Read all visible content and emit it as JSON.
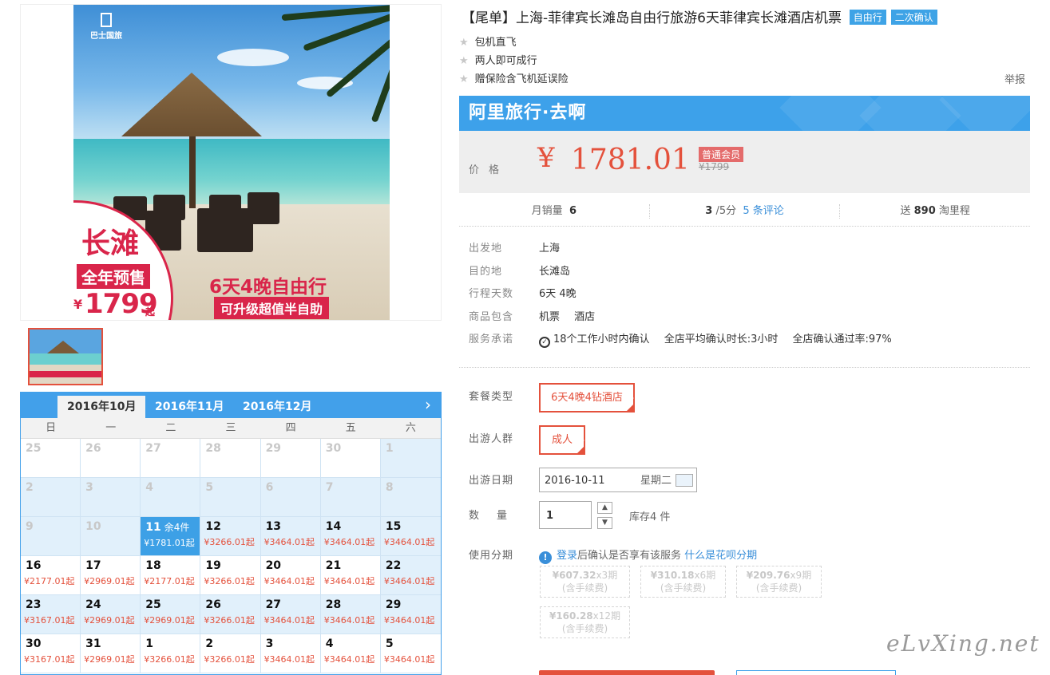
{
  "gallery": {
    "image_logo_text": "巴士国旅",
    "promo_place": "长滩",
    "promo_sale": "全年预售",
    "promo_price_symbol": "¥",
    "promo_price": "1799",
    "promo_price_suffix": "起",
    "promo_trip": "6天4晚自由行",
    "promo_upgrade": "可升级超值半自助"
  },
  "calendar": {
    "tabs": [
      "2016年10月",
      "2016年11月",
      "2016年12月"
    ],
    "active_tab": 0,
    "next_icon": "chevron-right-icon",
    "weekdays": [
      "日",
      "一",
      "二",
      "三",
      "四",
      "五",
      "六"
    ],
    "cells": [
      {
        "d": "25",
        "p": "",
        "bg": "white",
        "muted": true
      },
      {
        "d": "26",
        "p": "",
        "bg": "white",
        "muted": true
      },
      {
        "d": "27",
        "p": "",
        "bg": "white",
        "muted": true
      },
      {
        "d": "28",
        "p": "",
        "bg": "white",
        "muted": true
      },
      {
        "d": "29",
        "p": "",
        "bg": "white",
        "muted": true
      },
      {
        "d": "30",
        "p": "",
        "bg": "white",
        "muted": true
      },
      {
        "d": "1",
        "p": "",
        "bg": "blue",
        "muted": true
      },
      {
        "d": "2",
        "p": "",
        "bg": "blue",
        "muted": true
      },
      {
        "d": "3",
        "p": "",
        "bg": "blue",
        "muted": true
      },
      {
        "d": "4",
        "p": "",
        "bg": "blue",
        "muted": true
      },
      {
        "d": "5",
        "p": "",
        "bg": "blue",
        "muted": true
      },
      {
        "d": "6",
        "p": "",
        "bg": "blue",
        "muted": true
      },
      {
        "d": "7",
        "p": "",
        "bg": "blue",
        "muted": true
      },
      {
        "d": "8",
        "p": "",
        "bg": "blue",
        "muted": true
      },
      {
        "d": "9",
        "p": "",
        "bg": "blue",
        "muted": true
      },
      {
        "d": "10",
        "p": "",
        "bg": "blue",
        "muted": true
      },
      {
        "d": "11",
        "p": "¥1781.01起",
        "bg": "selected",
        "muted": false,
        "stock": "余4件"
      },
      {
        "d": "12",
        "p": "¥3266.01起",
        "bg": "blue",
        "muted": false
      },
      {
        "d": "13",
        "p": "¥3464.01起",
        "bg": "blue",
        "muted": false
      },
      {
        "d": "14",
        "p": "¥3464.01起",
        "bg": "blue",
        "muted": false
      },
      {
        "d": "15",
        "p": "¥3464.01起",
        "bg": "blue",
        "muted": false
      },
      {
        "d": "16",
        "p": "¥2177.01起",
        "bg": "white",
        "muted": false
      },
      {
        "d": "17",
        "p": "¥2969.01起",
        "bg": "white",
        "muted": false
      },
      {
        "d": "18",
        "p": "¥2177.01起",
        "bg": "white",
        "muted": false
      },
      {
        "d": "19",
        "p": "¥3266.01起",
        "bg": "white",
        "muted": false
      },
      {
        "d": "20",
        "p": "¥3464.01起",
        "bg": "white",
        "muted": false
      },
      {
        "d": "21",
        "p": "¥3464.01起",
        "bg": "white",
        "muted": false
      },
      {
        "d": "22",
        "p": "¥3464.01起",
        "bg": "blue",
        "muted": false
      },
      {
        "d": "23",
        "p": "¥3167.01起",
        "bg": "blue",
        "muted": false
      },
      {
        "d": "24",
        "p": "¥2969.01起",
        "bg": "blue",
        "muted": false
      },
      {
        "d": "25",
        "p": "¥2969.01起",
        "bg": "blue",
        "muted": false
      },
      {
        "d": "26",
        "p": "¥3266.01起",
        "bg": "blue",
        "muted": false
      },
      {
        "d": "27",
        "p": "¥3464.01起",
        "bg": "blue",
        "muted": false
      },
      {
        "d": "28",
        "p": "¥3464.01起",
        "bg": "blue",
        "muted": false
      },
      {
        "d": "29",
        "p": "¥3464.01起",
        "bg": "blue",
        "muted": false
      },
      {
        "d": "30",
        "p": "¥3167.01起",
        "bg": "white",
        "muted": false
      },
      {
        "d": "31",
        "p": "¥2969.01起",
        "bg": "white",
        "muted": false
      },
      {
        "d": "1",
        "p": "¥3266.01起",
        "bg": "white",
        "muted": false
      },
      {
        "d": "2",
        "p": "¥3266.01起",
        "bg": "white",
        "muted": false
      },
      {
        "d": "3",
        "p": "¥3464.01起",
        "bg": "white",
        "muted": false
      },
      {
        "d": "4",
        "p": "¥3464.01起",
        "bg": "white",
        "muted": false
      },
      {
        "d": "5",
        "p": "¥3464.01起",
        "bg": "white",
        "muted": false
      }
    ]
  },
  "product": {
    "title": "【尾单】上海-菲律宾长滩岛自由行旅游6天菲律宾长滩酒店机票",
    "tags": [
      "自由行",
      "二次确认"
    ],
    "features": [
      "包机直飞",
      "两人即可成行",
      "赠保险含飞机延误险"
    ],
    "report": "举报"
  },
  "price": {
    "brand": "阿里旅行·去啊",
    "label": "价格",
    "symbol": "¥",
    "value": "1781.01",
    "member_badge": "普通会员",
    "old_price": "¥1799"
  },
  "stats": {
    "monthly_sales_label": "月销量",
    "monthly_sales": "6",
    "rating": "3",
    "rating_suffix": "/5分",
    "reviews": "5 条评论",
    "points_prefix": "送",
    "points": "890",
    "points_suffix": "淘里程"
  },
  "info": [
    {
      "k": "出发地",
      "v": [
        "上海"
      ]
    },
    {
      "k": "目的地",
      "v": [
        "长滩岛"
      ]
    },
    {
      "k": "行程天数",
      "v": [
        "6天 4晚"
      ]
    },
    {
      "k": "商品包含",
      "v": [
        "机票",
        "酒店"
      ]
    },
    {
      "k": "服务承诺",
      "v": [
        "18个工作小时内确认",
        "全店平均确认时长:3小时",
        "全店确认通过率:97%"
      ]
    }
  ],
  "options": {
    "package_label": "套餐类型",
    "package_value": "6天4晚4钻酒店",
    "travelers_label": "出游人群",
    "travelers_value": "成人",
    "date_label": "出游日期",
    "date_value": "2016-10-11",
    "date_weekday": "星期二",
    "qty_label": "数量",
    "qty_value": "1",
    "stock_text": "库存4 件",
    "installment_label": "使用分期",
    "installment_login": "登录",
    "installment_text": "后确认是否享有该服务",
    "installment_link": "什么是花呗分期",
    "plans": [
      {
        "amt": "¥607.32",
        "n": "x3期",
        "fee": "(含手续费)"
      },
      {
        "amt": "¥310.18",
        "n": "x6期",
        "fee": "(含手续费)"
      },
      {
        "amt": "¥209.76",
        "n": "x9期",
        "fee": "(含手续费)"
      },
      {
        "amt": "¥160.28",
        "n": "x12期",
        "fee": "(含手续费)"
      }
    ]
  },
  "watermark": "eLvXing.net"
}
